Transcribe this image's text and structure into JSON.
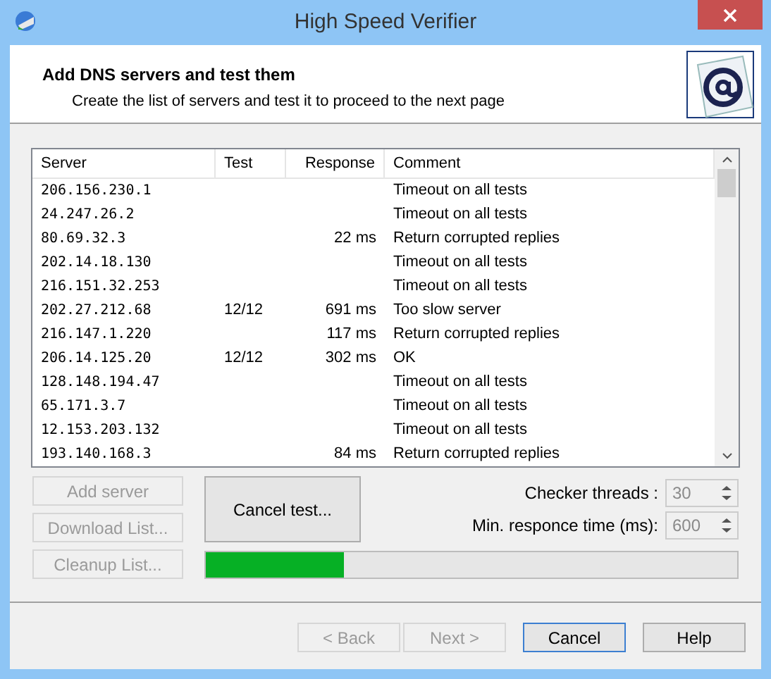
{
  "window": {
    "title": "High Speed Verifier"
  },
  "header": {
    "title": "Add DNS servers and test them",
    "subtitle": "Create the list of servers and test it to proceed to the next page"
  },
  "table": {
    "columns": [
      "Server",
      "Test",
      "Response",
      "Comment"
    ],
    "rows": [
      {
        "server": "206.156.230.1",
        "test": "",
        "response": "",
        "comment": "Timeout on all tests"
      },
      {
        "server": "24.247.26.2",
        "test": "",
        "response": "",
        "comment": "Timeout on all tests"
      },
      {
        "server": "80.69.32.3",
        "test": "",
        "response": "22 ms",
        "comment": "Return corrupted replies"
      },
      {
        "server": "202.14.18.130",
        "test": "",
        "response": "",
        "comment": "Timeout on all tests"
      },
      {
        "server": "216.151.32.253",
        "test": "",
        "response": "",
        "comment": "Timeout on all tests"
      },
      {
        "server": "202.27.212.68",
        "test": "12/12",
        "response": "691 ms",
        "comment": "Too slow server"
      },
      {
        "server": "216.147.1.220",
        "test": "",
        "response": "117 ms",
        "comment": "Return corrupted replies"
      },
      {
        "server": "206.14.125.20",
        "test": "12/12",
        "response": "302 ms",
        "comment": "OK"
      },
      {
        "server": "128.148.194.47",
        "test": "",
        "response": "",
        "comment": "Timeout on all tests"
      },
      {
        "server": "65.171.3.7",
        "test": "",
        "response": "",
        "comment": "Timeout on all tests"
      },
      {
        "server": "12.153.203.132",
        "test": "",
        "response": "",
        "comment": "Timeout on all tests"
      },
      {
        "server": "193.140.168.3",
        "test": "",
        "response": "84 ms",
        "comment": "Return corrupted replies"
      }
    ]
  },
  "side_buttons": [
    {
      "label": "Add server",
      "disabled": true
    },
    {
      "label": "Download List...",
      "disabled": true
    },
    {
      "label": "Cleanup List...",
      "disabled": true
    }
  ],
  "cancel_test": {
    "label": "Cancel test..."
  },
  "settings": [
    {
      "label": "Checker threads :",
      "value": "30",
      "disabled": true
    },
    {
      "label": "Min. responce time (ms):",
      "value": "600",
      "disabled": true
    }
  ],
  "progress": {
    "level": 0.26
  },
  "footer_buttons": [
    {
      "label": "< Back",
      "disabled": true,
      "default": false
    },
    {
      "label": "Next >",
      "disabled": true,
      "default": false
    },
    {
      "label": "Cancel",
      "disabled": false,
      "default": true
    },
    {
      "label": "Help",
      "disabled": false,
      "default": false
    }
  ]
}
